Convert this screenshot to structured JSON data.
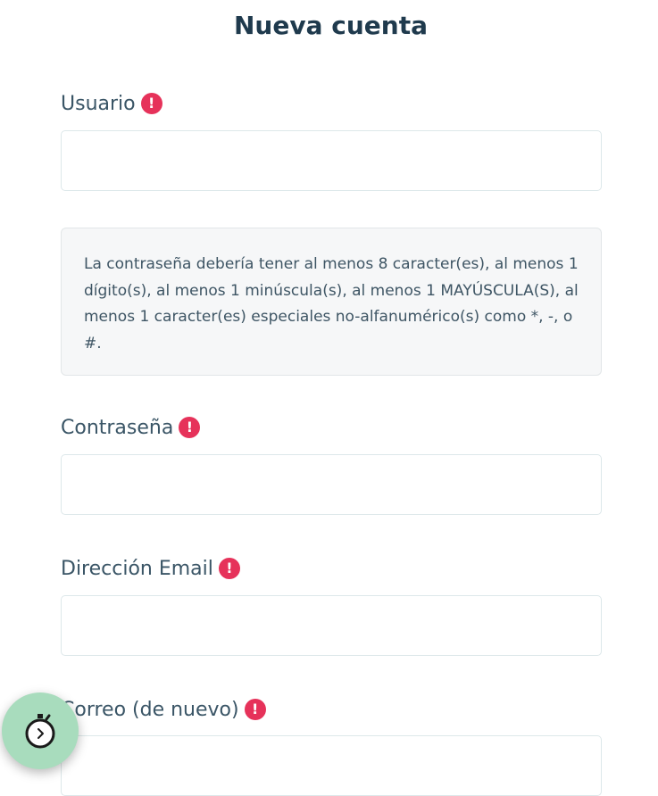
{
  "page": {
    "title": "Nueva cuenta"
  },
  "form": {
    "username": {
      "label": "Usuario",
      "value": "",
      "required_mark": "!"
    },
    "password_policy": "La contraseña debería tener al menos 8 caracter(es), al menos 1 dígito(s), al menos 1 minúscula(s), al menos 1 MAYÚSCULA(S), al menos 1 caracter(es) especiales no-alfanumérico(s) como *, -, o #.",
    "password": {
      "label": "Contraseña",
      "value": "",
      "required_mark": "!"
    },
    "email": {
      "label": "Dirección Email",
      "value": "",
      "required_mark": "!"
    },
    "email_confirm": {
      "label": "Correo (de nuevo)",
      "value": "",
      "required_mark": "!"
    }
  },
  "colors": {
    "title": "#1f3a4d",
    "label": "#3a5566",
    "required_badge": "#e6325a",
    "input_border": "#dde8ea",
    "policy_background": "#f6f7f8",
    "timer_fab": "#a8dcbd"
  },
  "icons": {
    "required": "exclamation-circle-icon",
    "timer": "stopwatch-icon"
  }
}
